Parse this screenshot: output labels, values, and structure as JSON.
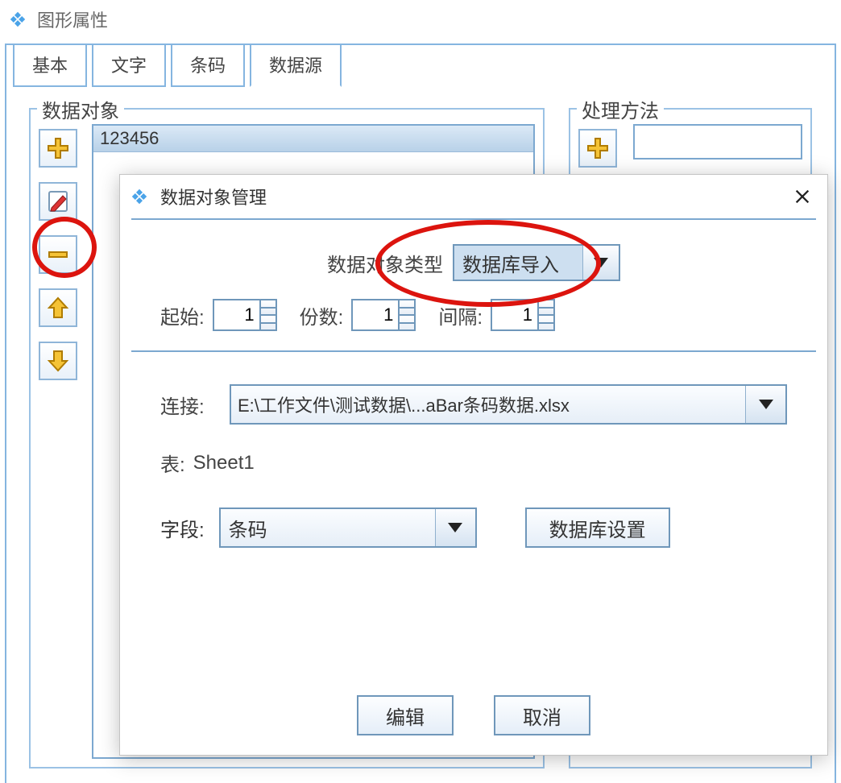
{
  "window": {
    "title": "图形属性"
  },
  "tabs": {
    "basic": "基本",
    "text": "文字",
    "barcode": "条码",
    "datasource": "数据源"
  },
  "left_group": {
    "legend": "数据对象",
    "list": {
      "item0": "123456"
    }
  },
  "right_group": {
    "legend": "处理方法"
  },
  "dialog": {
    "title": "数据对象管理",
    "type_label": "数据对象类型",
    "type_value": "数据库导入",
    "start_label": "起始:",
    "start_value": "1",
    "copies_label": "份数:",
    "copies_value": "1",
    "interval_label": "间隔:",
    "interval_value": "1",
    "connect_label": "连接:",
    "connect_value": "E:\\工作文件\\测试数据\\...aBar条码数据.xlsx",
    "sheet_label": "表:",
    "sheet_value": "Sheet1",
    "field_label": "字段:",
    "field_value": "条码",
    "db_settings": "数据库设置",
    "edit": "编辑",
    "cancel": "取消"
  }
}
